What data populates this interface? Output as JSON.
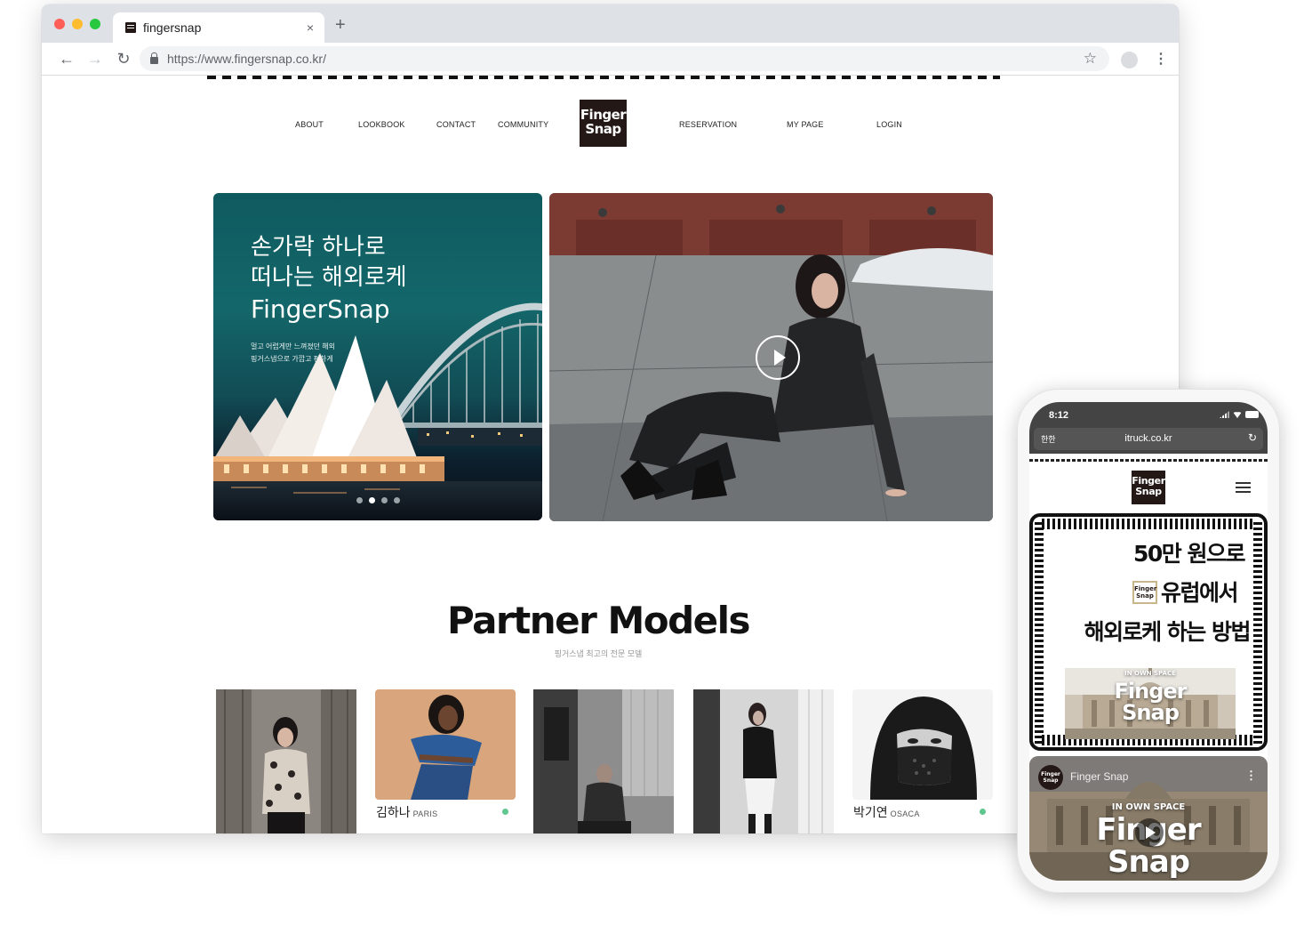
{
  "browser": {
    "tab_title": "fingersnap",
    "tab_close": "×",
    "new_tab": "+",
    "url": "https://www.fingersnap.co.kr/",
    "back": "←",
    "forward": "→",
    "reload": "↻",
    "star": "☆",
    "menu": "⋮"
  },
  "site": {
    "nav_left": [
      "ABOUT",
      "LOOKBOOK",
      "CONTACT",
      "COMMUNITY"
    ],
    "nav_right": [
      "RESERVATION",
      "MY PAGE",
      "LOGIN"
    ],
    "logo_line1": "Finger",
    "logo_line2": "Snap"
  },
  "hero": {
    "headline_1": "손가락 하나로",
    "headline_2": "떠나는 해외로케",
    "brand": "FingerSnap",
    "sub_1": "멀고 어렵게만 느껴졌던 해외",
    "sub_2": "핑거스냅으로 가깝고 편하게",
    "slide_count": 4,
    "active_slide": 2
  },
  "partners": {
    "title": "Partner Models",
    "subtitle": "핑거스냅 최고의 전문 모델",
    "models": [
      {
        "name": "",
        "city": ""
      },
      {
        "name": "김하나",
        "city": "PARIS"
      },
      {
        "name": "",
        "city": ""
      },
      {
        "name": "",
        "city": ""
      },
      {
        "name": "박기연",
        "city": "OSACA"
      }
    ]
  },
  "phone": {
    "time": "8:12",
    "aa": "한한",
    "url": "itruck.co.kr",
    "reload": "↻",
    "logo_line1": "Finger",
    "logo_line2": "Snap",
    "banner_line1": "50만 원으로",
    "banner_line2": "유럽에서",
    "banner_line3": "해외로케 하는 방법",
    "mini_logo_1": "Finger",
    "mini_logo_2": "Snap",
    "img_kicker": "IN OWN SPACE",
    "img_brand_1": "Finger",
    "img_brand_2": "Snap",
    "video_badge_1": "Finger",
    "video_badge_2": "Snap",
    "video_title": "Finger Snap",
    "video_more": "⋮",
    "video_kicker": "IN OWN SPACE",
    "video_brand_1": "Finger",
    "video_brand_2": "Snap"
  },
  "colors": {
    "brand_dark": "#231815",
    "online_dot": "#5fc78f",
    "hero_teal": "#13676a"
  }
}
